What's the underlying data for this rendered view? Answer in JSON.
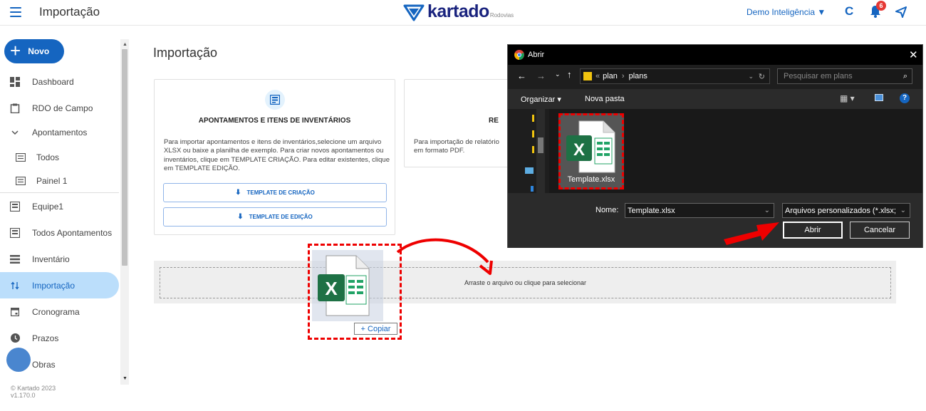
{
  "header": {
    "title": "Importação",
    "logo_text": "kartado",
    "logo_sub": "Rodovias",
    "user_menu": "Demo Inteligência ▼",
    "notification_count": "6"
  },
  "sidebar": {
    "new_button": "Novo",
    "items": [
      {
        "label": "Dashboard",
        "icon": "dashboard-icon"
      },
      {
        "label": "RDO de Campo",
        "icon": "clipboard-icon"
      },
      {
        "label": "Apontamentos",
        "icon": "chevron-down-icon"
      },
      {
        "label": "Todos",
        "icon": "list-icon"
      },
      {
        "label": "Painel 1",
        "icon": "list-icon"
      },
      {
        "label": "Equipe1",
        "icon": "list-icon"
      },
      {
        "label": "Todos Apontamentos",
        "icon": "list-icon"
      },
      {
        "label": "Inventário",
        "icon": "inventory-icon"
      },
      {
        "label": "Importação",
        "icon": "import-icon",
        "active": true
      },
      {
        "label": "Cronograma",
        "icon": "calendar-icon"
      },
      {
        "label": "Prazos",
        "icon": "clock-icon"
      },
      {
        "label": "Obras",
        "icon": "construction-icon"
      }
    ],
    "footer_copyright": "© Kartado 2023",
    "footer_version": "v1.170.0"
  },
  "main": {
    "page_title": "Importação",
    "card1": {
      "title": "APONTAMENTOS E ITENS DE INVENTÁRIOS",
      "text": "Para importar apontamentos e itens de inventários,selecione um arquivo XLSX ou baixe a planilha de exemplo. Para criar novos apontamentos ou inventários, clique em TEMPLATE CRIAÇÃO. Para editar existentes, clique em TEMPLATE EDIÇÃO.",
      "btn_create": "TEMPLATE DE CRIAÇÃO",
      "btn_edit": "TEMPLATE DE EDIÇÃO"
    },
    "card2": {
      "title": "RE",
      "text_line1": "Para importação de relatório",
      "text_line2": "em formato PDF."
    },
    "dropzone_text": "Arraste o arquivo ou clique para selecionar",
    "drag_copy_label": "+ Copiar"
  },
  "dialog": {
    "title": "Abrir",
    "path_prefix": "«",
    "path_part1": "plan",
    "path_part2": "plans",
    "search_placeholder": "Pesquisar em plans",
    "organize": "Organizar ▾",
    "new_folder": "Nova pasta",
    "file_name": "Template.xlsx",
    "name_label": "Nome:",
    "name_value": "Template.xlsx",
    "type_value": "Arquivos personalizados (*.xlsx;",
    "open_button": "Abrir",
    "cancel_button": "Cancelar"
  },
  "colors": {
    "brand": "#1565c0",
    "active_bg": "#bbdefb",
    "highlight": "#ee0000"
  }
}
